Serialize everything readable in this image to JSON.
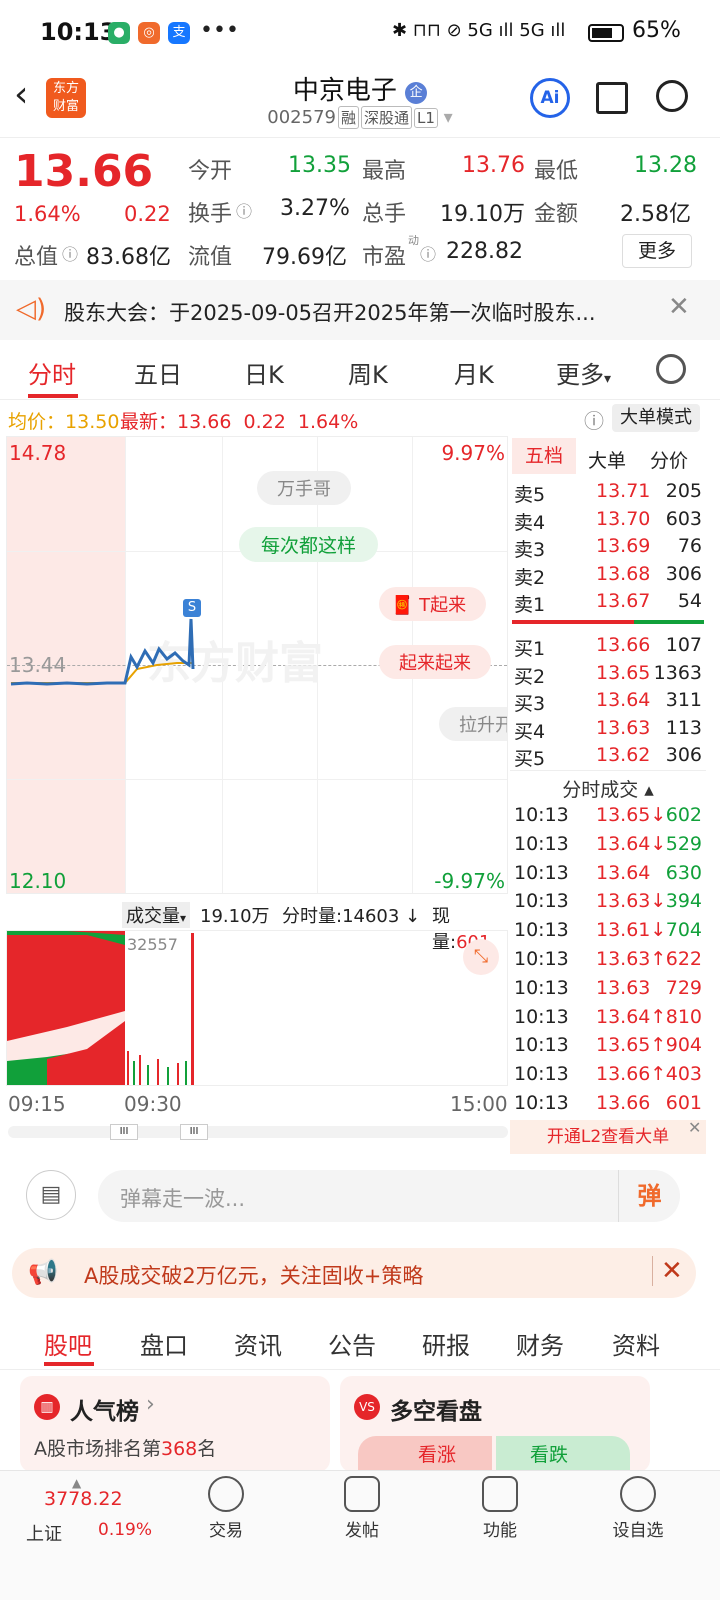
{
  "status": {
    "time": "10:13",
    "battery": "65",
    "right_icons": "✱ ⊓⊓ ⊘ 5G ıll 5G ıll"
  },
  "header": {
    "name": "中京电子",
    "badge": "企",
    "code": "002579",
    "tags": [
      "融",
      "深股通",
      "L1"
    ]
  },
  "quote": {
    "price": "13.66",
    "pct": "1.64%",
    "chg": "0.22",
    "fields": [
      {
        "label": "今开",
        "value": "13.35",
        "color": "green"
      },
      {
        "label": "最高",
        "value": "13.76",
        "color": "red"
      },
      {
        "label": "最低",
        "value": "13.28",
        "color": "green"
      },
      {
        "label": "换手",
        "value": "3.27%",
        "color": "black"
      },
      {
        "label": "总手",
        "value": "19.10万",
        "color": "black"
      },
      {
        "label": "金额",
        "value": "2.58亿",
        "color": "black"
      },
      {
        "label": "总值",
        "value": "83.68亿",
        "color": "black"
      },
      {
        "label": "流值",
        "value": "79.69亿",
        "color": "black"
      },
      {
        "label": "市盈",
        "value": "228.82",
        "color": "black"
      }
    ],
    "more": "更多",
    "pe_sup": "动"
  },
  "notice": "股东大会：于2025-09-05召开2025年第一次临时股东...",
  "tabs": [
    "分时",
    "五日",
    "日K",
    "周K",
    "月K",
    "更多"
  ],
  "avgline": {
    "avg_label": "均价：",
    "avg": "13.50",
    "latest_label": "最新：",
    "latest": "13.66",
    "chg": "0.22",
    "pct": "1.64%",
    "bigmode": "大单模式"
  },
  "chart": {
    "high": "14.78",
    "low": "12.10",
    "ref": "13.44",
    "high_pct": "9.97%",
    "low_pct": "-9.97%",
    "watermark": "东方财富",
    "bullets": [
      "万手哥",
      "每次都这样",
      "T起来",
      "起来起来",
      "拉升开"
    ],
    "vol_label": "成交量",
    "vol_total": "19.10万",
    "vol_fen": "分时量:14603",
    "vol_now_label": "现量:",
    "vol_now": "601",
    "vol_max": "32557",
    "times": [
      "09:15",
      "09:30",
      "15:00"
    ]
  },
  "orderbook": {
    "tabs": [
      "五档",
      "大单",
      "分价"
    ],
    "sells": [
      [
        "卖5",
        "13.71",
        "205"
      ],
      [
        "卖4",
        "13.70",
        "603"
      ],
      [
        "卖3",
        "13.69",
        "76"
      ],
      [
        "卖2",
        "13.68",
        "306"
      ],
      [
        "卖1",
        "13.67",
        "54"
      ]
    ],
    "buys": [
      [
        "买1",
        "13.66",
        "107"
      ],
      [
        "买2",
        "13.65",
        "1363"
      ],
      [
        "买3",
        "13.64",
        "311"
      ],
      [
        "买4",
        "13.63",
        "113"
      ],
      [
        "买5",
        "13.62",
        "306"
      ]
    ],
    "trade_title": "分时成交"
  },
  "trades": [
    [
      "10:13",
      "13.65↓",
      "602",
      "green"
    ],
    [
      "10:13",
      "13.64↓",
      "529",
      "green"
    ],
    [
      "10:13",
      "13.64",
      "630",
      "green"
    ],
    [
      "10:13",
      "13.63↓",
      "394",
      "green"
    ],
    [
      "10:13",
      "13.61↓",
      "704",
      "green"
    ],
    [
      "10:13",
      "13.63↑",
      "622",
      "red"
    ],
    [
      "10:13",
      "13.63",
      "729",
      "red"
    ],
    [
      "10:13",
      "13.64↑",
      "810",
      "red"
    ],
    [
      "10:13",
      "13.65↑",
      "904",
      "red"
    ],
    [
      "10:13",
      "13.66↑",
      "403",
      "red"
    ],
    [
      "10:13",
      "13.66",
      "601",
      "red"
    ]
  ],
  "l2": "开通L2查看大单",
  "danmu": {
    "placeholder": "弹幕走一波...",
    "btn": "弹"
  },
  "ad": "A股成交破2万亿元，关注固收+策略",
  "bottabs": [
    "股吧",
    "盘口",
    "资讯",
    "公告",
    "研报",
    "财务",
    "资料"
  ],
  "cards": {
    "pop_title": "人气榜",
    "pop_sub_a": "A股市场排名第",
    "pop_rank": "368",
    "pop_sub_b": "名",
    "vs_title": "多空看盘",
    "up": "看涨",
    "down": "看跌"
  },
  "nav": {
    "index_value": "3778.22",
    "index_name": "上证",
    "index_pct": "0.19%",
    "items": [
      "交易",
      "发帖",
      "功能",
      "设自选"
    ]
  }
}
